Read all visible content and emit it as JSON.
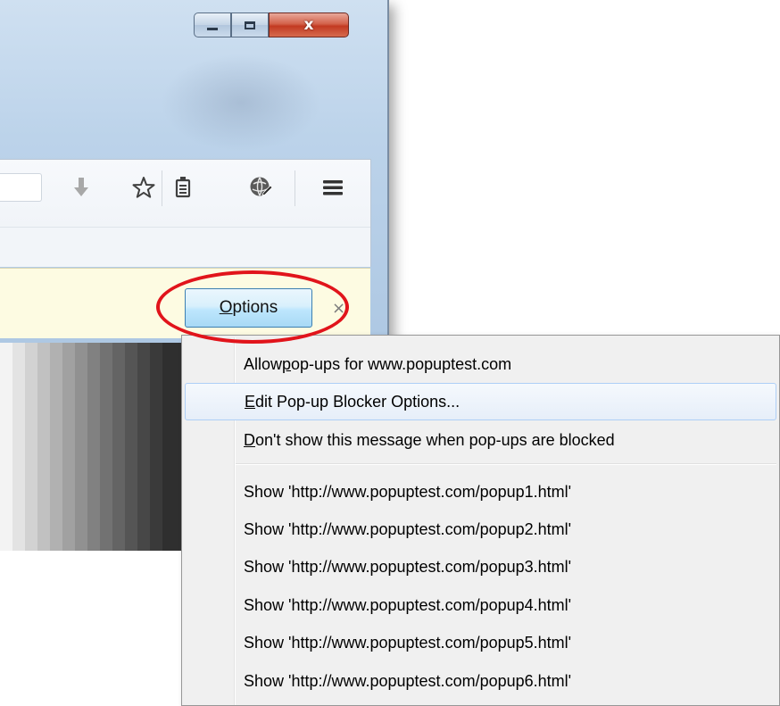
{
  "window": {
    "controls": {
      "minimize_icon": "minimize-icon",
      "maximize_icon": "maximize-icon",
      "close_glyph": "x"
    }
  },
  "toolbar": {
    "icons": [
      "download-arrow-icon",
      "bookmark-star-icon",
      "reading-list-icon",
      "globe-addon-icon",
      "hamburger-menu-icon"
    ]
  },
  "notification": {
    "options_label_mnemonic": "O",
    "options_label_rest": "ptions",
    "close_glyph": "×"
  },
  "menu": {
    "items": [
      {
        "pre": "Allow ",
        "mnemonic": "p",
        "post": "op-ups for www.popuptest.com"
      },
      {
        "pre": "",
        "mnemonic": "E",
        "post": "dit Pop-up Blocker Options..."
      },
      {
        "pre": "",
        "mnemonic": "D",
        "post": "on't show this message when pop-ups are blocked"
      }
    ],
    "popup_items": [
      "Show 'http://www.popuptest.com/popup1.html'",
      "Show 'http://www.popuptest.com/popup2.html'",
      "Show 'http://www.popuptest.com/popup3.html'",
      "Show 'http://www.popuptest.com/popup4.html'",
      "Show 'http://www.popuptest.com/popup5.html'",
      "Show 'http://www.popuptest.com/popup6.html'"
    ]
  },
  "colors": {
    "highlight_ring": "#e1141b",
    "notification_bg": "#fdfbe2",
    "menu_hover_border": "#aecff7"
  }
}
